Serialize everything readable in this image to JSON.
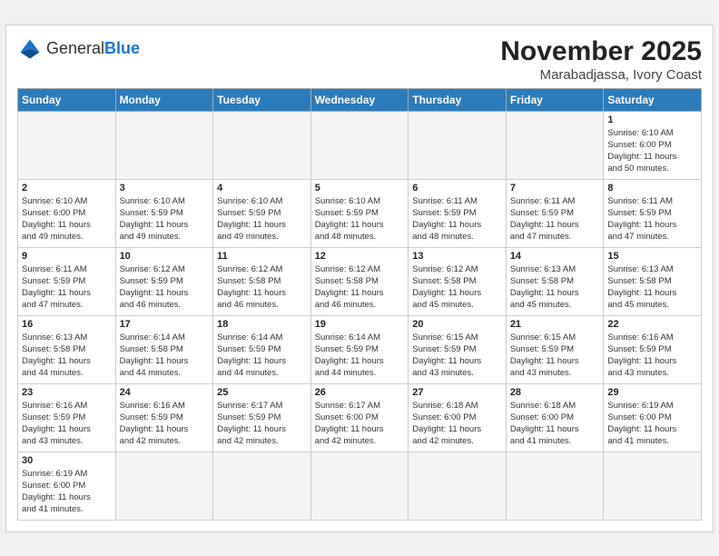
{
  "header": {
    "logo_general": "General",
    "logo_blue": "Blue",
    "month_year": "November 2025",
    "location": "Marabadjassa, Ivory Coast"
  },
  "weekdays": [
    "Sunday",
    "Monday",
    "Tuesday",
    "Wednesday",
    "Thursday",
    "Friday",
    "Saturday"
  ],
  "weeks": [
    [
      {
        "date": "",
        "info": ""
      },
      {
        "date": "",
        "info": ""
      },
      {
        "date": "",
        "info": ""
      },
      {
        "date": "",
        "info": ""
      },
      {
        "date": "",
        "info": ""
      },
      {
        "date": "",
        "info": ""
      },
      {
        "date": "1",
        "info": "Sunrise: 6:10 AM\nSunset: 6:00 PM\nDaylight: 11 hours\nand 50 minutes."
      }
    ],
    [
      {
        "date": "2",
        "info": "Sunrise: 6:10 AM\nSunset: 6:00 PM\nDaylight: 11 hours\nand 49 minutes."
      },
      {
        "date": "3",
        "info": "Sunrise: 6:10 AM\nSunset: 5:59 PM\nDaylight: 11 hours\nand 49 minutes."
      },
      {
        "date": "4",
        "info": "Sunrise: 6:10 AM\nSunset: 5:59 PM\nDaylight: 11 hours\nand 49 minutes."
      },
      {
        "date": "5",
        "info": "Sunrise: 6:10 AM\nSunset: 5:59 PM\nDaylight: 11 hours\nand 48 minutes."
      },
      {
        "date": "6",
        "info": "Sunrise: 6:11 AM\nSunset: 5:59 PM\nDaylight: 11 hours\nand 48 minutes."
      },
      {
        "date": "7",
        "info": "Sunrise: 6:11 AM\nSunset: 5:59 PM\nDaylight: 11 hours\nand 47 minutes."
      },
      {
        "date": "8",
        "info": "Sunrise: 6:11 AM\nSunset: 5:59 PM\nDaylight: 11 hours\nand 47 minutes."
      }
    ],
    [
      {
        "date": "9",
        "info": "Sunrise: 6:11 AM\nSunset: 5:59 PM\nDaylight: 11 hours\nand 47 minutes."
      },
      {
        "date": "10",
        "info": "Sunrise: 6:12 AM\nSunset: 5:59 PM\nDaylight: 11 hours\nand 46 minutes."
      },
      {
        "date": "11",
        "info": "Sunrise: 6:12 AM\nSunset: 5:58 PM\nDaylight: 11 hours\nand 46 minutes."
      },
      {
        "date": "12",
        "info": "Sunrise: 6:12 AM\nSunset: 5:58 PM\nDaylight: 11 hours\nand 46 minutes."
      },
      {
        "date": "13",
        "info": "Sunrise: 6:12 AM\nSunset: 5:58 PM\nDaylight: 11 hours\nand 45 minutes."
      },
      {
        "date": "14",
        "info": "Sunrise: 6:13 AM\nSunset: 5:58 PM\nDaylight: 11 hours\nand 45 minutes."
      },
      {
        "date": "15",
        "info": "Sunrise: 6:13 AM\nSunset: 5:58 PM\nDaylight: 11 hours\nand 45 minutes."
      }
    ],
    [
      {
        "date": "16",
        "info": "Sunrise: 6:13 AM\nSunset: 5:58 PM\nDaylight: 11 hours\nand 44 minutes."
      },
      {
        "date": "17",
        "info": "Sunrise: 6:14 AM\nSunset: 5:58 PM\nDaylight: 11 hours\nand 44 minutes."
      },
      {
        "date": "18",
        "info": "Sunrise: 6:14 AM\nSunset: 5:59 PM\nDaylight: 11 hours\nand 44 minutes."
      },
      {
        "date": "19",
        "info": "Sunrise: 6:14 AM\nSunset: 5:59 PM\nDaylight: 11 hours\nand 44 minutes."
      },
      {
        "date": "20",
        "info": "Sunrise: 6:15 AM\nSunset: 5:59 PM\nDaylight: 11 hours\nand 43 minutes."
      },
      {
        "date": "21",
        "info": "Sunrise: 6:15 AM\nSunset: 5:59 PM\nDaylight: 11 hours\nand 43 minutes."
      },
      {
        "date": "22",
        "info": "Sunrise: 6:16 AM\nSunset: 5:59 PM\nDaylight: 11 hours\nand 43 minutes."
      }
    ],
    [
      {
        "date": "23",
        "info": "Sunrise: 6:16 AM\nSunset: 5:59 PM\nDaylight: 11 hours\nand 43 minutes."
      },
      {
        "date": "24",
        "info": "Sunrise: 6:16 AM\nSunset: 5:59 PM\nDaylight: 11 hours\nand 42 minutes."
      },
      {
        "date": "25",
        "info": "Sunrise: 6:17 AM\nSunset: 5:59 PM\nDaylight: 11 hours\nand 42 minutes."
      },
      {
        "date": "26",
        "info": "Sunrise: 6:17 AM\nSunset: 6:00 PM\nDaylight: 11 hours\nand 42 minutes."
      },
      {
        "date": "27",
        "info": "Sunrise: 6:18 AM\nSunset: 6:00 PM\nDaylight: 11 hours\nand 42 minutes."
      },
      {
        "date": "28",
        "info": "Sunrise: 6:18 AM\nSunset: 6:00 PM\nDaylight: 11 hours\nand 41 minutes."
      },
      {
        "date": "29",
        "info": "Sunrise: 6:19 AM\nSunset: 6:00 PM\nDaylight: 11 hours\nand 41 minutes."
      }
    ],
    [
      {
        "date": "30",
        "info": "Sunrise: 6:19 AM\nSunset: 6:00 PM\nDaylight: 11 hours\nand 41 minutes."
      },
      {
        "date": "",
        "info": ""
      },
      {
        "date": "",
        "info": ""
      },
      {
        "date": "",
        "info": ""
      },
      {
        "date": "",
        "info": ""
      },
      {
        "date": "",
        "info": ""
      },
      {
        "date": "",
        "info": ""
      }
    ]
  ]
}
